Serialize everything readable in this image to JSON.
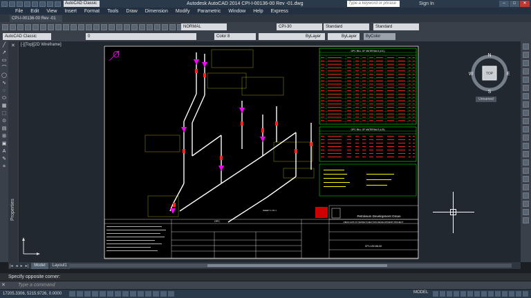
{
  "window": {
    "app_title": "Autodesk AutoCAD 2014   CPI-I-00136-00 Rev -01.dwg",
    "workspace": "AutoCAD Classic",
    "search_placeholder": "Type a keyword or phrase",
    "signin": "Sign In"
  },
  "menu": [
    "File",
    "Edit",
    "View",
    "Insert",
    "Format",
    "Tools",
    "Draw",
    "Dimension",
    "Modify",
    "Parametric",
    "Window",
    "Help",
    "Express"
  ],
  "doc_tab": "CPI-I-00136-00 Rev -01",
  "toolbar": {
    "workspace_combo": "AutoCAD Classic",
    "layer_combo": "0",
    "dimstyle": "NORMAL",
    "textstyle": "CPI-30",
    "tablestyle": "Standard",
    "mleaderstyle": "Standard",
    "color": "Color 8",
    "linetype": "ByLayer",
    "lineweight": "ByLayer",
    "plotstyle": "ByColor"
  },
  "viewport": {
    "label": "[-][Top][2D Wireframe]",
    "viewcube": {
      "top": "TOP",
      "n": "N",
      "s": "S",
      "e": "E",
      "w": "W"
    },
    "wcs": "Unnamed"
  },
  "drawing": {
    "bom_title_1": "GPC BILL OF MATERIALS (GC)",
    "bom_title_2": "GPC BILL OF MATERIALS (UG)",
    "company": "Petroleum Development Oman",
    "project": "OMAN GPS  ST WATER INJECTION DEVELOPMENT PROJECT",
    "drawing_no": "CPI-I-00136-00",
    "client": "OPC",
    "sheet": "SHEET 1 OF 1"
  },
  "palette": {
    "properties_label": "Properties"
  },
  "layout_tabs": [
    "Model",
    "Layout1"
  ],
  "command": {
    "history": "Specify opposite corner:",
    "prompt": "Type a command"
  },
  "status": {
    "coords": "17205.3306, 5215.9726, 0.0000",
    "model": "MODEL"
  }
}
